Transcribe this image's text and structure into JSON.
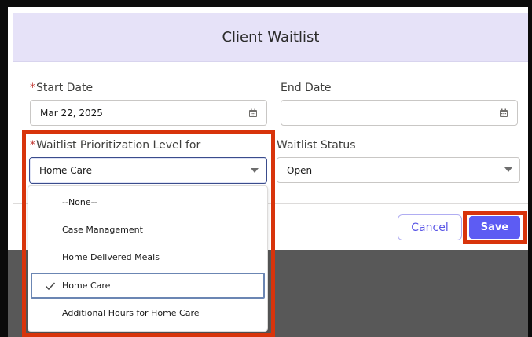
{
  "modal": {
    "title": "Client Waitlist"
  },
  "form": {
    "required_marker": "*",
    "start_date": {
      "label": "Start Date",
      "value": "Mar 22, 2025"
    },
    "end_date": {
      "label": "End Date",
      "value": ""
    },
    "prioritization": {
      "label": "Waitlist Prioritization Level for",
      "value": "Home Care"
    },
    "status": {
      "label": "Waitlist Status",
      "value": "Open"
    }
  },
  "dropdown": {
    "options": [
      {
        "label": "--None--"
      },
      {
        "label": "Case Management"
      },
      {
        "label": "Home Delivered Meals"
      },
      {
        "label": "Home Care",
        "selected": true
      },
      {
        "label": "Additional Hours for Home Care"
      }
    ]
  },
  "buttons": {
    "cancel": "Cancel",
    "save": "Save"
  },
  "icons": {
    "calendar": "calendar-icon",
    "caret": "chevron-down-icon",
    "check": "check-icon"
  },
  "colors": {
    "header_bg": "#e6e2f8",
    "save_bg": "#5d5cf3",
    "cancel_text": "#5a56e6",
    "highlight": "#d8340b",
    "required": "#c23934"
  }
}
